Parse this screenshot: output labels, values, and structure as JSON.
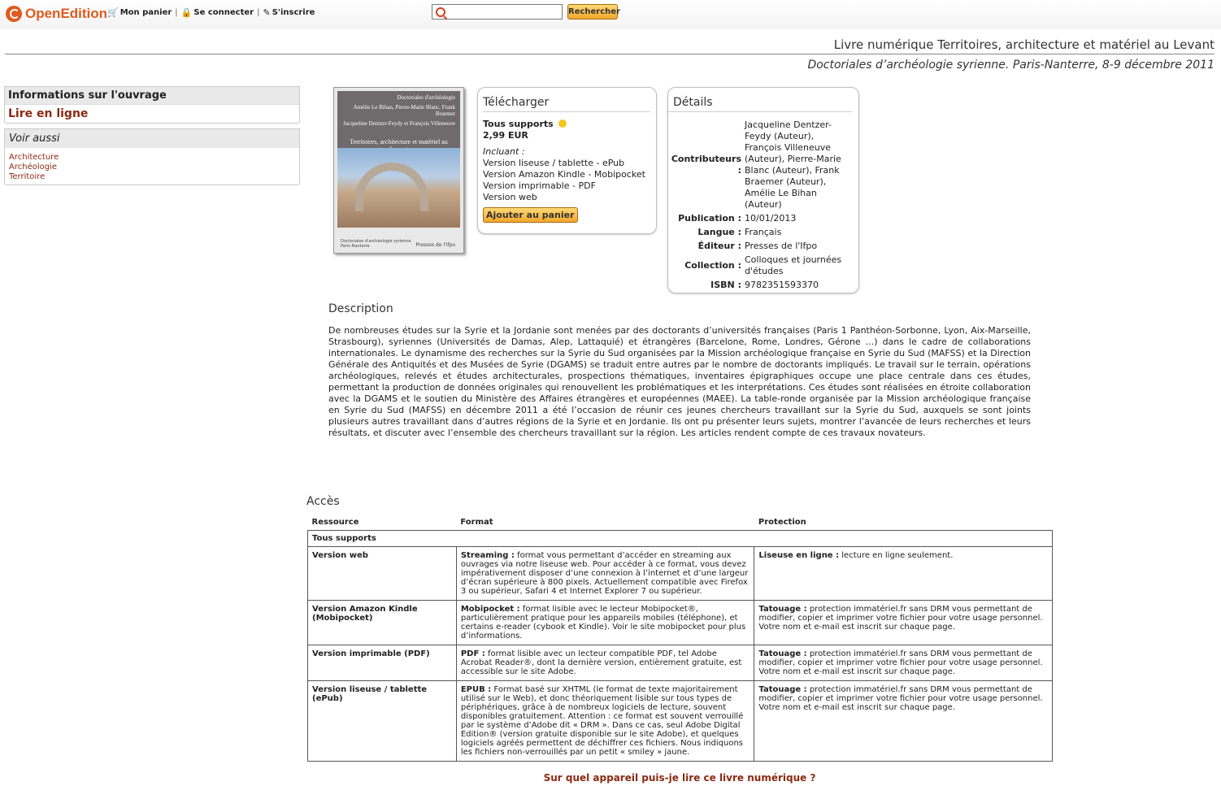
{
  "topbar": {
    "logo_text": "OpenEdition",
    "cart_label": "Mon panier",
    "login_label": "Se connecter",
    "signup_label": "S'inscrire",
    "search_placeholder": "",
    "search_button": "Rechercher"
  },
  "header": {
    "title": "Livre numérique Territoires, architecture et matériel au Levant",
    "subtitle": "Doctoriales d’archéologie syrienne. Paris-Nanterre, 8-9 décembre 2011"
  },
  "sidebar": {
    "info_label": "Informations sur l'ouvrage",
    "read_online": "Lire en ligne",
    "see_also": "Voir aussi",
    "links": [
      "Architecture",
      "Archéologie",
      "Territoire"
    ]
  },
  "cover": {
    "top_line1": "Doctoriales d'archéologie",
    "top_line2": "Amélie Le Bihan, Pierre-Marie Blanc, Frank Braemer",
    "top_line3": "Jacqueline Dentzer-Feydy et François Villeneuve",
    "title": "Territoires, architecture et matériel au Levant",
    "bottom_left1": "Doctoriales d'archéologie syrienne",
    "bottom_left2": "Paris-Nanterre",
    "publisher": "Presses de l'Ifpo"
  },
  "download": {
    "title": "Télécharger",
    "supports": "Tous supports",
    "price": "2,99 EUR",
    "included_label": "Incluant :",
    "versions": [
      "Version liseuse / tablette - ePub",
      "Version Amazon Kindle - Mobipocket",
      "Version imprimable - PDF",
      "Version web"
    ],
    "cart_button": "Ajouter au panier"
  },
  "details": {
    "title": "Détails",
    "contributors_label": "Contributeurs :",
    "contributors": "Jacqueline Dentzer-Feydy (Auteur), François Villeneuve (Auteur), Pierre-Marie Blanc (Auteur), Frank Braemer (Auteur), Amélie Le Bihan (Auteur)",
    "publication_label": "Publication :",
    "publication": "10/01/2013",
    "language_label": "Langue :",
    "language": "Français",
    "publisher_label": "Éditeur :",
    "publisher": "Presses de l'Ifpo",
    "collection_label": "Collection :",
    "collection": "Colloques et journées d'études",
    "isbn_label": "ISBN :",
    "isbn": "9782351593370"
  },
  "description": {
    "title": "Description",
    "text": "De nombreuses études sur la Syrie et la Jordanie sont menées par des doctorants d’universités françaises (Paris 1 Panthéon-Sorbonne, Lyon, Aix-Marseille, Strasbourg), syriennes (Universités de Damas, Alep, Lattaquié) et étrangères (Barcelone, Rome, Londres, Gérone ...) dans le cadre de collaborations internationales. Le dynamisme des recherches sur la Syrie du Sud organisées par la Mission archéologique française en Syrie du Sud (MAFSS) et la Direction Générale des Antiquités et des Musées de Syrie (DGAMS) se traduit entre autres par le nombre de doctorants impliqués. Le travail sur le terrain, opérations archéologiques, relevés et études architecturales, prospections thématiques, inventaires épigraphiques occupe une place centrale dans ces études, permettant la production de données originales qui renouvellent les problématiques et les interprétations. Ces études sont réalisées en étroite collaboration avec la DGAMS et le soutien du Ministère des Affaires étrangères et européennes (MAEE). La table-ronde organisée par la Mission archéologique française en Syrie du Sud (MAFSS) en décembre 2011 a été l’occasion de réunir ces jeunes chercheurs travaillant sur la Syrie du Sud, auxquels se sont joints plusieurs autres travaillant dans d’autres régions de la Syrie et en Jordanie. Ils ont pu présenter leurs sujets, montrer l’avancée de leurs recherches et leurs résultats, et discuter avec l’ensemble des chercheurs travaillant sur la région. Les articles rendent compte de ces travaux novateurs."
  },
  "access": {
    "title": "Accès",
    "headers": [
      "Ressource",
      "Format",
      "Protection"
    ],
    "group_label": "Tous supports",
    "rows": [
      {
        "resource": "Version web",
        "format_lead": "Streaming :",
        "format_text": "format vous permettant d’accéder en streaming aux ouvrages via notre liseuse web. Pour accéder à ce format, vous devez impérativement disposer d’une connexion à l’internet et d’une largeur d’écran supérieure à 800 pixels. Actuellement compatible avec Firefox 3 ou supérieur, Safari 4 et Internet Explorer 7 ou supérieur.",
        "protection_lead": "Liseuse en ligne :",
        "protection_text": "lecture en ligne seulement."
      },
      {
        "resource": "Version Amazon Kindle (Mobipocket)",
        "format_lead": "Mobipocket :",
        "format_text": "format lisible avec le lecteur Mobipocket®, particulièrement pratique pour les appareils mobiles (téléphone), et certains e-reader (cybook et Kindle). Voir le site mobipocket pour plus d’informations.",
        "protection_lead": "Tatouage :",
        "protection_text": "protection immatériel.fr sans DRM vous permettant de modifier, copier et imprimer votre fichier pour votre usage personnel. Votre nom et e-mail est inscrit sur chaque page."
      },
      {
        "resource": "Version imprimable (PDF)",
        "format_lead": "PDF :",
        "format_text": "format lisible avec un lecteur compatible PDF, tel Adobe Acrobat Reader®, dont la dernière version, entièrement gratuite, est accessible sur le site Adobe.",
        "protection_lead": "Tatouage :",
        "protection_text": "protection immatériel.fr sans DRM vous permettant de modifier, copier et imprimer votre fichier pour votre usage personnel. Votre nom et e-mail est inscrit sur chaque page."
      },
      {
        "resource": "Version liseuse / tablette (ePub)",
        "format_lead": "EPUB :",
        "format_text": "Format basé sur XHTML (le format de texte majoritairement utilisé sur le Web), et donc théoriquement lisible sur tous types de périphériques, grâce à de nombreux logiciels de lecture, souvent disponibles gratuitement. Attention : ce format est souvent verrouillé par le système d’Adobe dit « DRM ». Dans ce cas, seul Adobe Digital Edition® (version gratuite disponible sur le site Adobe), et quelques logiciels agréés permettent de déchiffrer ces fichiers. Nous indiquons les fichiers non-verrouillés par un petit « smiley » jaune.",
        "protection_lead": "Tatouage :",
        "protection_text": "protection immatériel.fr sans DRM vous permettant de modifier, copier et imprimer votre fichier pour votre usage personnel. Votre nom et e-mail est inscrit sur chaque page."
      }
    ]
  },
  "footer_question": "Sur quel appareil puis-je lire ce livre numérique ?",
  "colors": {
    "brand_orange": "#e05a1d",
    "link_red": "#8b2a12",
    "button_gold": "#f2a72c"
  }
}
